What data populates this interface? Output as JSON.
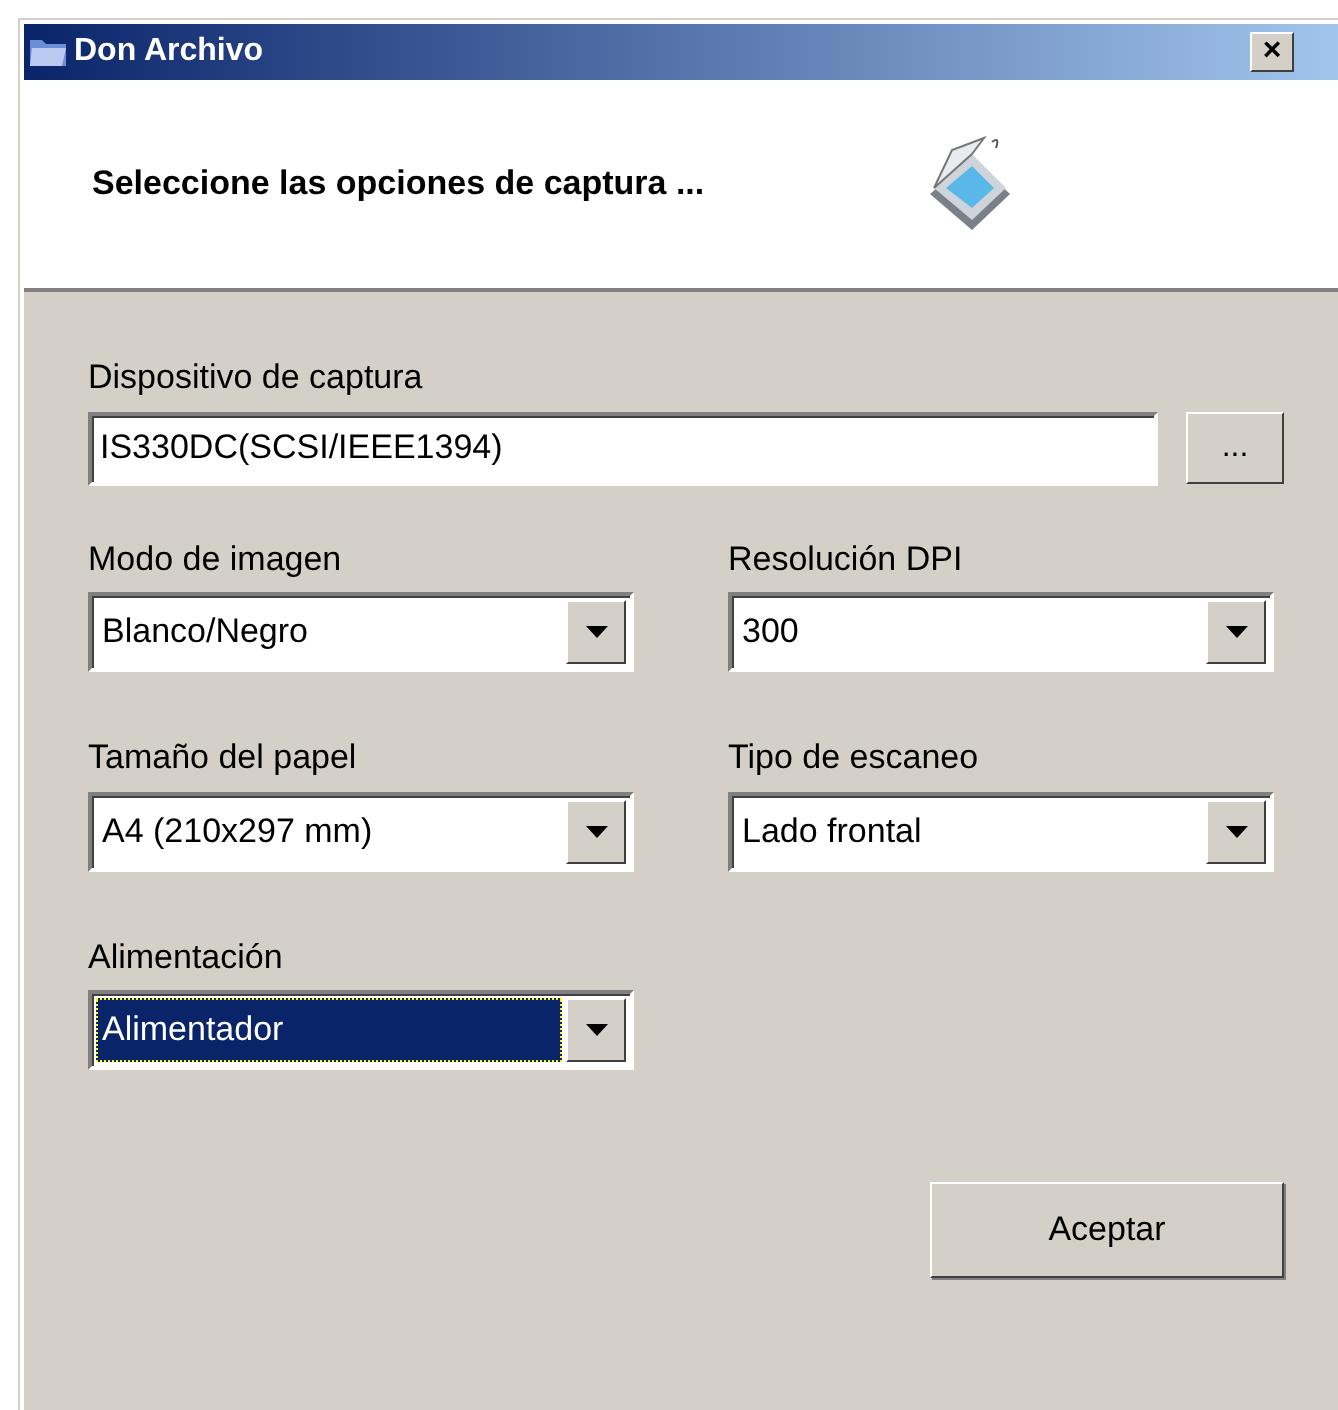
{
  "window": {
    "title": "Don Archivo",
    "close": "×"
  },
  "header": {
    "title": "Seleccione las opciones de captura ..."
  },
  "device": {
    "label": "Dispositivo de captura",
    "value": "IS330DC(SCSI/IEEE1394)",
    "browse": "..."
  },
  "selects": [
    {
      "label": "Modo de imagen",
      "value": "Blanco/Negro",
      "focused": false
    },
    {
      "label": "Resolución DPI",
      "value": "300",
      "focused": false
    },
    {
      "label": "Tamaño del papel",
      "value": "A4 (210x297 mm)",
      "focused": false
    },
    {
      "label": "Tipo de escaneo",
      "value": "Lado frontal",
      "focused": false
    },
    {
      "label": "Alimentación",
      "value": "Alimentador",
      "focused": true
    }
  ],
  "buttons": [
    {
      "label": "Aceptar"
    }
  ]
}
